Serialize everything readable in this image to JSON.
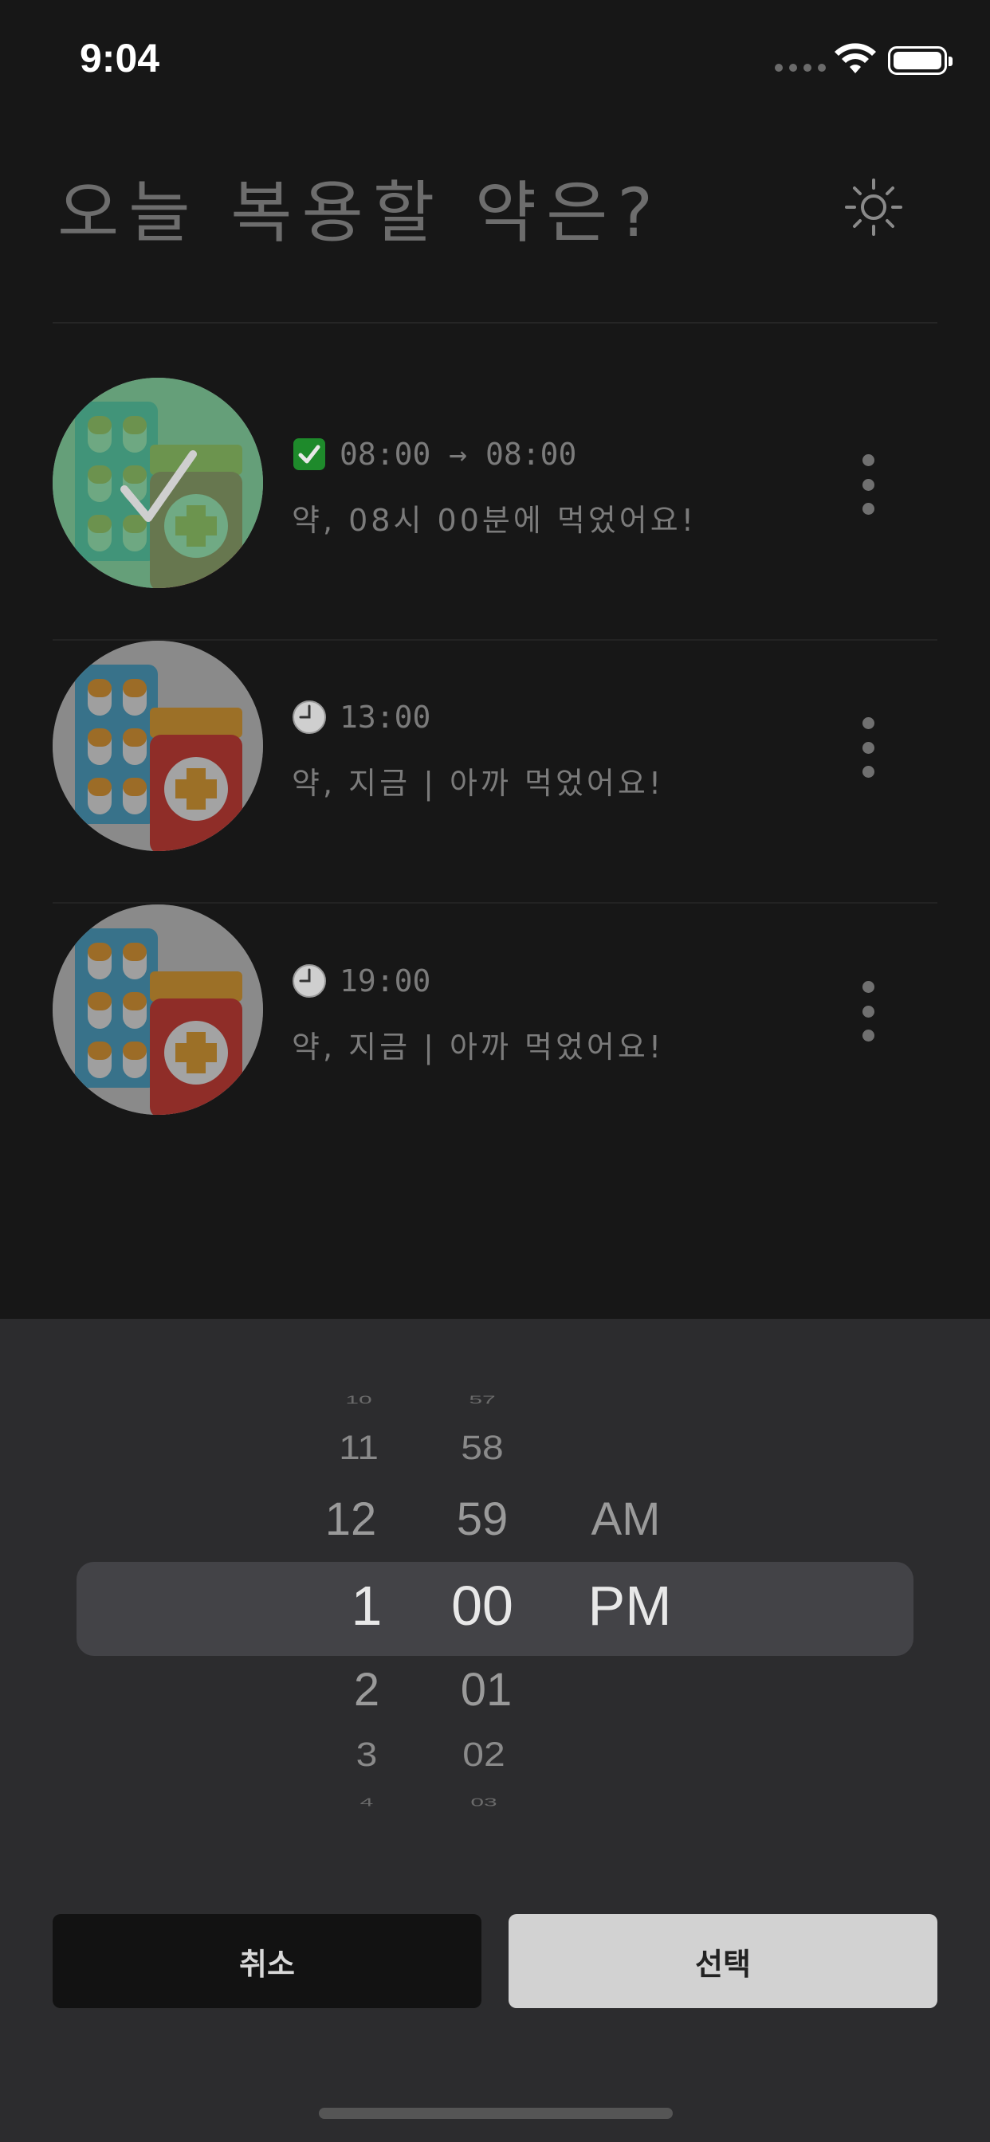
{
  "status_bar": {
    "time": "9:04"
  },
  "header": {
    "title": "오늘 복용할 약은?",
    "theme_icon": "sun-icon"
  },
  "medications": [
    {
      "time_text": "08:00 → 08:00",
      "message": "약, 08시 00분에 먹었어요!",
      "status_icon": "check-box-icon",
      "taken": true
    },
    {
      "time_text": "13:00",
      "message": "약, 지금 | 아까 먹었어요!",
      "status_icon": "clock-icon",
      "taken": false
    },
    {
      "time_text": "19:00",
      "message": "약, 지금 | 아까 먹었어요!",
      "status_icon": "clock-icon",
      "taken": false
    }
  ],
  "time_picker": {
    "hours": [
      "10",
      "11",
      "12",
      "1",
      "2",
      "3",
      "4"
    ],
    "minutes": [
      "57",
      "58",
      "59",
      "00",
      "01",
      "02",
      "03"
    ],
    "periods": [
      "AM",
      "PM"
    ],
    "selected": {
      "hour": "1",
      "minute": "00",
      "period": "PM"
    }
  },
  "actions": {
    "cancel_label": "취소",
    "select_label": "선택"
  },
  "colors": {
    "background": "#171717",
    "sheet": "#2c2c2e",
    "selection": "#434347",
    "taken_tint": "#3f8f5a",
    "check_green": "#1e8a2b"
  }
}
